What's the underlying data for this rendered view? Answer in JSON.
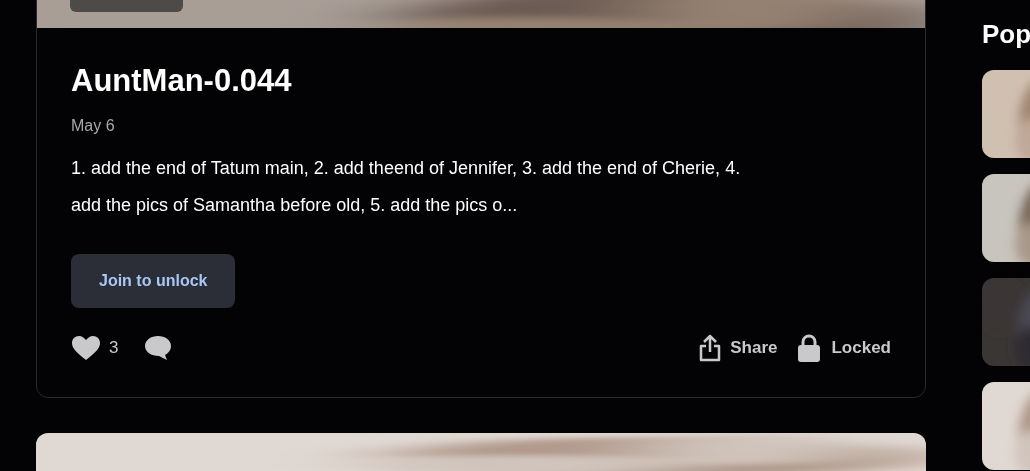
{
  "post": {
    "title": "AuntMan-0.044",
    "date": "May 6",
    "teaser": "1. add the end of Tatum main, 2. add theend of Jennifer, 3. add the end of Cherie, 4. add the pics of Samantha before old, 5. add the pics o...",
    "unlock_button": "Join to unlock",
    "likes": "3",
    "share": "Share",
    "locked": "Locked"
  },
  "popular": {
    "title": "Pop"
  }
}
